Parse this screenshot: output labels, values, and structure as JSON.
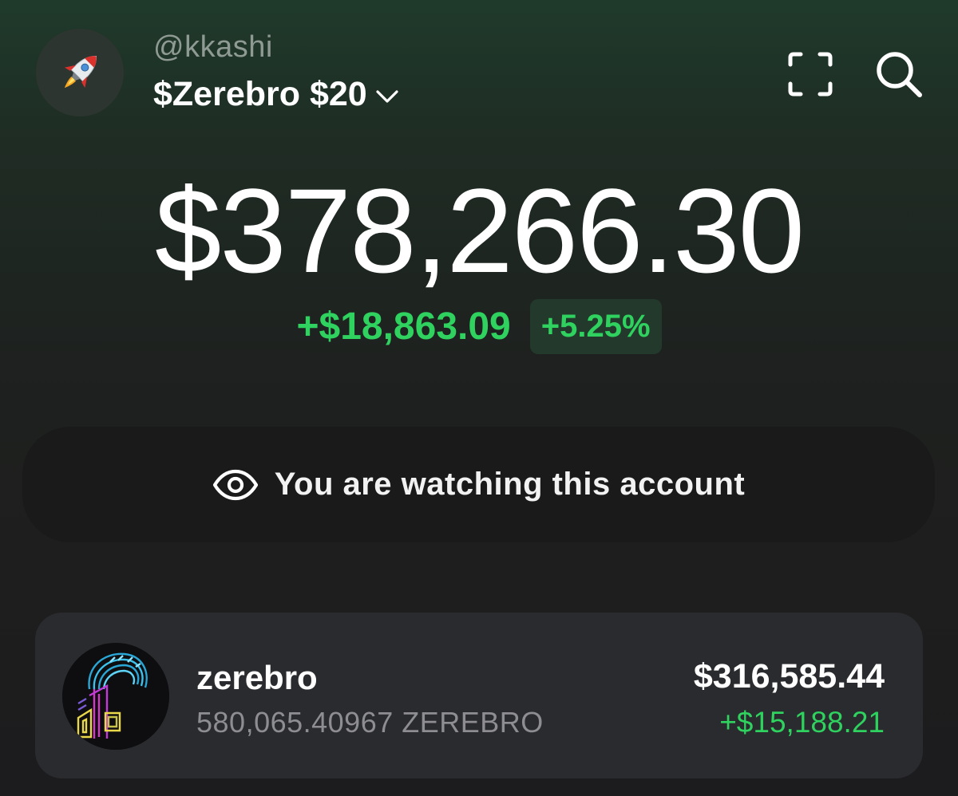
{
  "header": {
    "avatar_icon": "rocket-icon",
    "username": "@kkashi",
    "account_name": "$Zerebro $20",
    "scan_icon": "scan-frame-icon",
    "search_icon": "search-icon"
  },
  "portfolio": {
    "balance": "$378,266.30",
    "change_amount": "+$18,863.09",
    "change_percent": "+5.25%"
  },
  "watch_banner": {
    "icon": "eye-icon",
    "text": "You are watching this account"
  },
  "holdings": [
    {
      "icon": "zerebro-token-icon",
      "name": "zerebro",
      "quantity": "580,065.40967 ZEREBRO",
      "value": "$316,585.44",
      "change": "+$15,188.21"
    }
  ],
  "colors": {
    "positive": "#2fd15f",
    "positive_bg": "#22392b",
    "card_bg": "#2a2b2e",
    "banner_bg": "#1a1a1a",
    "muted_text": "#8d8d92"
  }
}
